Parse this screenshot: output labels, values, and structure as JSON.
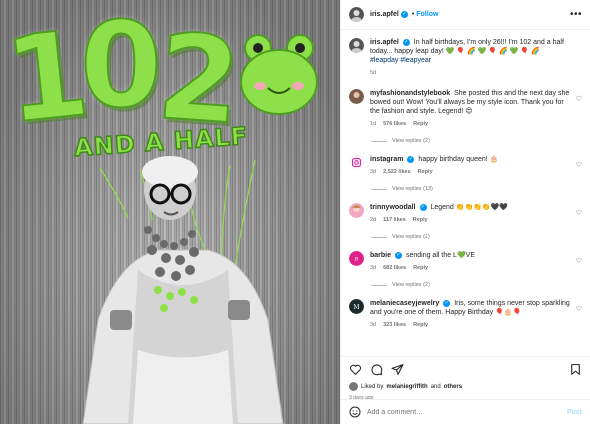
{
  "photo": {
    "balloon_digits": [
      "1",
      "0",
      "2"
    ],
    "banner_text": "AND A HALF"
  },
  "colors": {
    "balloon_green": "#8ee04a",
    "link_blue": "#0095f6",
    "hashtag_blue": "#00376b",
    "heart_red": "#ed4956"
  },
  "header": {
    "username": "iris.apfel",
    "follow_label": "Follow",
    "more_icon": "more-horizontal-icon"
  },
  "caption": {
    "username": "iris.apfel",
    "text": "In half birthdays, I'm only 26!!! I'm 102 and a half today... happy leap day! 💚 🎈 🌈 💚 🎈 🌈 💚 🎈 🌈",
    "hashtags": "#leapday #leapyear",
    "time": "5d"
  },
  "comments": [
    {
      "username": "myfashionandstylebook",
      "text": "She posted this and the next day she bowed out! Wow! You'll always be my style icon. Thank you for the fashion and style. Legend! 😍",
      "time": "1d",
      "likes": "576 likes",
      "reply": "Reply",
      "view_replies": "View replies (2)",
      "verified": false
    },
    {
      "username": "instagram",
      "text": "happy birthday queen! 🎂",
      "time": "3d",
      "likes": "2,522 likes",
      "reply": "Reply",
      "view_replies": "View replies (13)",
      "verified": true
    },
    {
      "username": "trinnywoodall",
      "text": "Legend 👏👏👏👏🖤🖤",
      "time": "2d",
      "likes": "117 likes",
      "reply": "Reply",
      "view_replies": "View replies (1)",
      "verified": true
    },
    {
      "username": "barbie",
      "text": "sending all the L💚VE",
      "time": "3d",
      "likes": "682 likes",
      "reply": "Reply",
      "view_replies": "View replies (2)",
      "verified": true
    },
    {
      "username": "melaniecaseyjewelry",
      "text": "Iris, some things never stop sparkling and you're one of them. Happy Birthday 🎈🎂🎈",
      "time": "3d",
      "likes": "323 likes",
      "reply": "Reply",
      "view_replies": "",
      "verified": true
    }
  ],
  "footer": {
    "liked_prefix": "Liked by",
    "liked_user": "melaniegriffith",
    "liked_and": "and",
    "liked_others": "others",
    "date": "3 days ago",
    "add_comment_placeholder": "Add a comment…",
    "post_label": "Post"
  }
}
